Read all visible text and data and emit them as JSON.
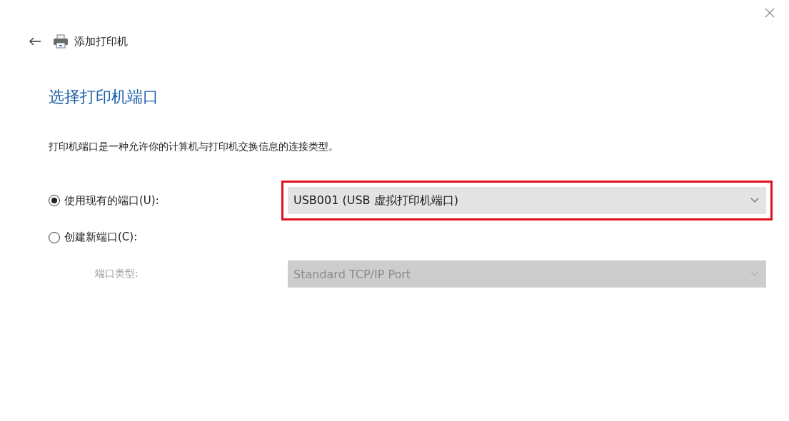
{
  "window": {
    "title": "添加打印机"
  },
  "heading": "选择打印机端口",
  "description": "打印机端口是一种允许你的计算机与打印机交换信息的连接类型。",
  "port_options": [
    {
      "label": "使用现有的端口(U):",
      "selected": true,
      "dropdown": {
        "value": "USB001 (USB 虚拟打印机端口)",
        "disabled": false,
        "highlighted": true
      }
    },
    {
      "label": "创建新端口(C):",
      "selected": false
    }
  ],
  "port_type": {
    "label": "端口类型:",
    "disabled": true,
    "dropdown": {
      "value": "Standard TCP/IP Port",
      "disabled": true
    }
  }
}
